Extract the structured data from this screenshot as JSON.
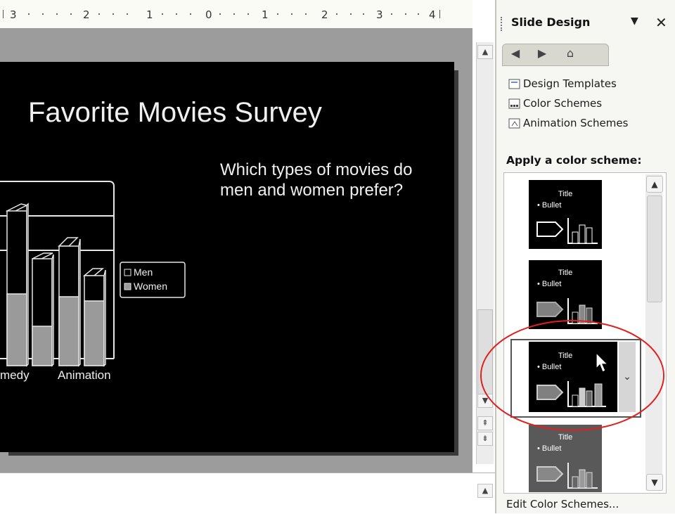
{
  "ruler": {
    "marks": [
      "3",
      "2",
      "1",
      "0",
      "1",
      "2",
      "3",
      "4"
    ]
  },
  "slide": {
    "title": "Favorite Movies Survey",
    "body": "Which types of movies do men and women prefer?",
    "chart": {
      "x_labels": [
        "medy",
        "Animation"
      ],
      "legend": [
        "Men",
        "Women"
      ]
    }
  },
  "task_pane": {
    "title": "Slide Design",
    "nav": {
      "back_icon": "back-arrow-icon",
      "forward_icon": "forward-arrow-icon",
      "home_icon": "home-icon"
    },
    "links": [
      {
        "label": "Design Templates",
        "icon": "design-templates-icon"
      },
      {
        "label": "Color Schemes",
        "icon": "color-schemes-icon"
      },
      {
        "label": "Animation Schemes",
        "icon": "animation-schemes-icon"
      }
    ],
    "apply_heading": "Apply a color scheme:",
    "schemes": [
      {
        "title": "Title",
        "bullet": "• Bullet",
        "bg": "#000000"
      },
      {
        "title": "Title",
        "bullet": "• Bullet",
        "bg": "#000000"
      },
      {
        "title": "Title",
        "bullet": "• Bullet",
        "bg": "#000000"
      },
      {
        "title": "Title",
        "bullet": "• Bullet",
        "bg": "#595959"
      }
    ],
    "edit_link": "Edit Color Schemes..."
  },
  "colors": {
    "slide_bg": "#000000",
    "highlight_circle": "#e02020",
    "pane_bg": "#f6f6f2"
  }
}
